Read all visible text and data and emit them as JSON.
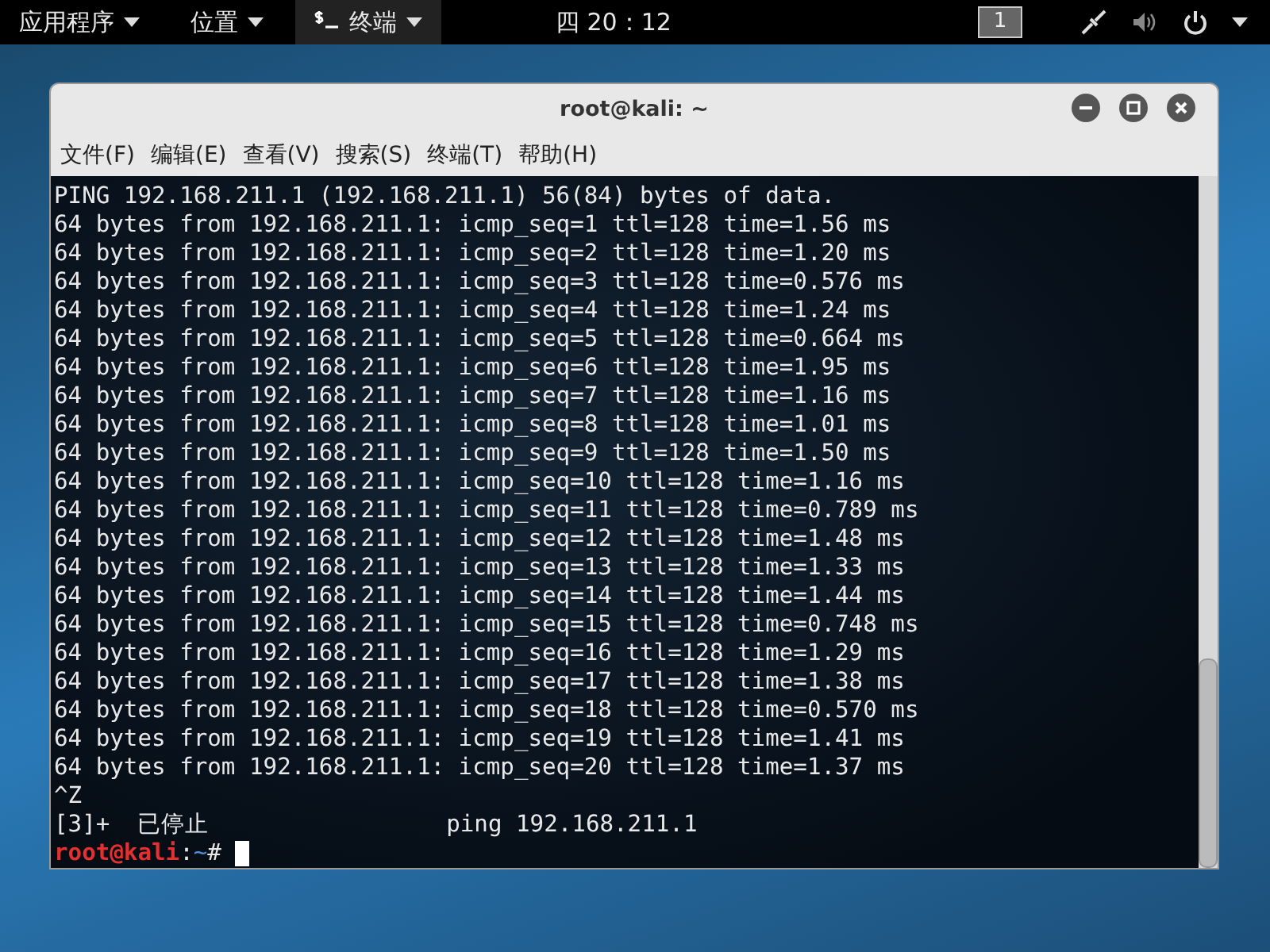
{
  "top_bar": {
    "menus": [
      {
        "label": "应用程序",
        "kind": "menu",
        "selected": false
      },
      {
        "label": "位置",
        "kind": "menu",
        "selected": false
      },
      {
        "label": "终端",
        "kind": "app",
        "selected": true
      }
    ],
    "clock": "四 20：12",
    "workspace": "1"
  },
  "window": {
    "title": "root@kali: ~",
    "menu": [
      "文件(F)",
      "编辑(E)",
      "查看(V)",
      "搜索(S)",
      "终端(T)",
      "帮助(H)"
    ]
  },
  "terminal": {
    "lines": [
      {
        "kind": "plain",
        "text": "PING 192.168.211.1 (192.168.211.1) 56(84) bytes of data."
      },
      {
        "kind": "plain",
        "text": "64 bytes from 192.168.211.1: icmp_seq=1 ttl=128 time=1.56 ms"
      },
      {
        "kind": "plain",
        "text": "64 bytes from 192.168.211.1: icmp_seq=2 ttl=128 time=1.20 ms"
      },
      {
        "kind": "plain",
        "text": "64 bytes from 192.168.211.1: icmp_seq=3 ttl=128 time=0.576 ms"
      },
      {
        "kind": "plain",
        "text": "64 bytes from 192.168.211.1: icmp_seq=4 ttl=128 time=1.24 ms"
      },
      {
        "kind": "plain",
        "text": "64 bytes from 192.168.211.1: icmp_seq=5 ttl=128 time=0.664 ms"
      },
      {
        "kind": "plain",
        "text": "64 bytes from 192.168.211.1: icmp_seq=6 ttl=128 time=1.95 ms"
      },
      {
        "kind": "plain",
        "text": "64 bytes from 192.168.211.1: icmp_seq=7 ttl=128 time=1.16 ms"
      },
      {
        "kind": "plain",
        "text": "64 bytes from 192.168.211.1: icmp_seq=8 ttl=128 time=1.01 ms"
      },
      {
        "kind": "plain",
        "text": "64 bytes from 192.168.211.1: icmp_seq=9 ttl=128 time=1.50 ms"
      },
      {
        "kind": "plain",
        "text": "64 bytes from 192.168.211.1: icmp_seq=10 ttl=128 time=1.16 ms"
      },
      {
        "kind": "plain",
        "text": "64 bytes from 192.168.211.1: icmp_seq=11 ttl=128 time=0.789 ms"
      },
      {
        "kind": "plain",
        "text": "64 bytes from 192.168.211.1: icmp_seq=12 ttl=128 time=1.48 ms"
      },
      {
        "kind": "plain",
        "text": "64 bytes from 192.168.211.1: icmp_seq=13 ttl=128 time=1.33 ms"
      },
      {
        "kind": "plain",
        "text": "64 bytes from 192.168.211.1: icmp_seq=14 ttl=128 time=1.44 ms"
      },
      {
        "kind": "plain",
        "text": "64 bytes from 192.168.211.1: icmp_seq=15 ttl=128 time=0.748 ms"
      },
      {
        "kind": "plain",
        "text": "64 bytes from 192.168.211.1: icmp_seq=16 ttl=128 time=1.29 ms"
      },
      {
        "kind": "plain",
        "text": "64 bytes from 192.168.211.1: icmp_seq=17 ttl=128 time=1.38 ms"
      },
      {
        "kind": "plain",
        "text": "64 bytes from 192.168.211.1: icmp_seq=18 ttl=128 time=0.570 ms"
      },
      {
        "kind": "plain",
        "text": "64 bytes from 192.168.211.1: icmp_seq=19 ttl=128 time=1.41 ms"
      },
      {
        "kind": "plain",
        "text": "64 bytes from 192.168.211.1: icmp_seq=20 ttl=128 time=1.37 ms"
      },
      {
        "kind": "plain",
        "text": "^Z"
      },
      {
        "kind": "plain",
        "text": "[3]+  已停止                 ping 192.168.211.1"
      },
      {
        "kind": "prompt",
        "user_host": "root@kali",
        "separator": ":",
        "path": "~",
        "symbol": "#"
      }
    ]
  }
}
